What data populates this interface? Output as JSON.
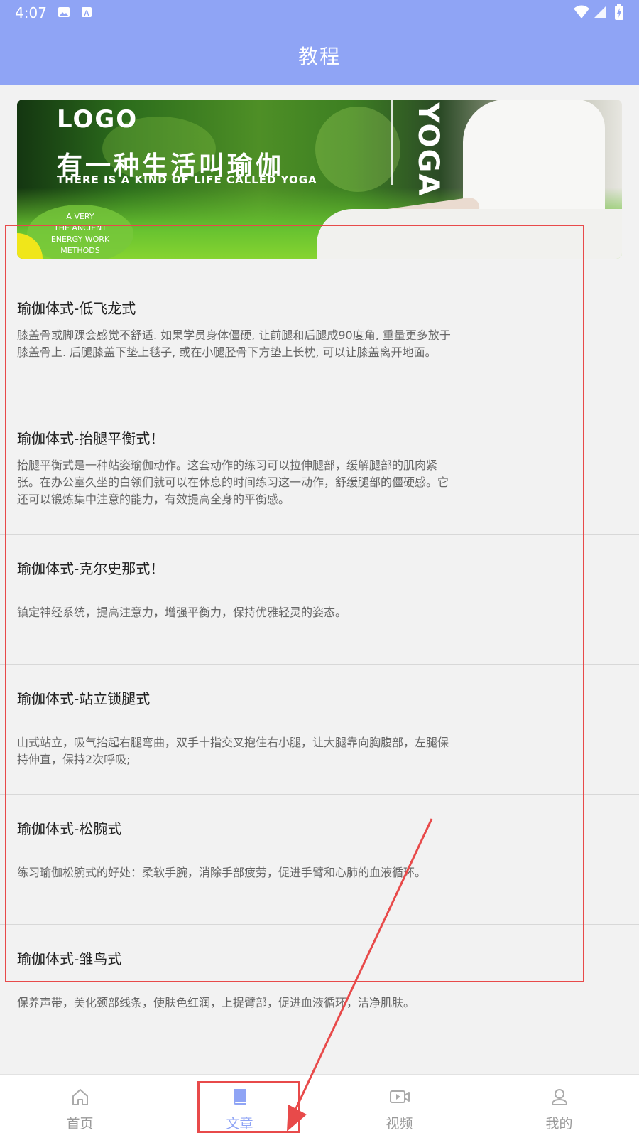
{
  "status_bar": {
    "time": "4:07",
    "left_icons": [
      "image-icon",
      "a-icon"
    ],
    "right_icons": [
      "wifi-icon",
      "signal-icon",
      "battery-icon"
    ]
  },
  "header": {
    "title": "教程"
  },
  "banner": {
    "logo": "LOGO",
    "headline": "有一种生活叫瑜伽",
    "subheadline": "THERE IS A KIND OF LIFE CALLED YOGA",
    "vertical_text": "YOGA",
    "badge_lines": [
      "A VERY",
      "THE ANCIENT",
      "ENERGY WORK",
      "METHODS"
    ]
  },
  "articles": [
    {
      "title": "瑜伽体式-低飞龙式",
      "desc": "膝盖骨或脚踝会感觉不舒适. 如果学员身体僵硬, 让前腿和后腿成90度角, 重量更多放于膝盖骨上. 后腿膝盖下垫上毯子, 或在小腿胫骨下方垫上长枕, 可以让膝盖离开地面。"
    },
    {
      "title": "瑜伽体式-抬腿平衡式！",
      "desc": "抬腿平衡式是一种站姿瑜伽动作。这套动作的练习可以拉伸腿部，缓解腿部的肌肉紧张。在办公室久坐的白领们就可以在休息的时间练习这一动作，舒缓腿部的僵硬感。它还可以锻炼集中注意的能力，有效提高全身的平衡感。"
    },
    {
      "title": "瑜伽体式-克尔史那式！",
      "desc": "镇定神经系统，提高注意力，增强平衡力，保持优雅轻灵的姿态。"
    },
    {
      "title": "瑜伽体式-站立锁腿式",
      "desc": "山式站立，吸气抬起右腿弯曲，双手十指交叉抱住右小腿，让大腿靠向胸腹部，左腿保持伸直，保持2次呼吸;"
    },
    {
      "title": "瑜伽体式-松腕式",
      "desc": "练习瑜伽松腕式的好处：柔软手腕，消除手部疲劳，促进手臂和心肺的血液循环。"
    },
    {
      "title": "瑜伽体式-雏鸟式",
      "desc": "保养声带，美化颈部线条，使肤色红润，上提臂部，促进血液循环，洁净肌肤。"
    }
  ],
  "tabs": [
    {
      "label": "首页",
      "icon": "home-icon",
      "active": false
    },
    {
      "label": "文章",
      "icon": "book-icon",
      "active": true
    },
    {
      "label": "视频",
      "icon": "video-icon",
      "active": false
    },
    {
      "label": "我的",
      "icon": "person-icon",
      "active": false
    }
  ],
  "colors": {
    "primary": "#8fa4f5",
    "background": "#f2f2f2",
    "annotation": "#e84a4a"
  }
}
